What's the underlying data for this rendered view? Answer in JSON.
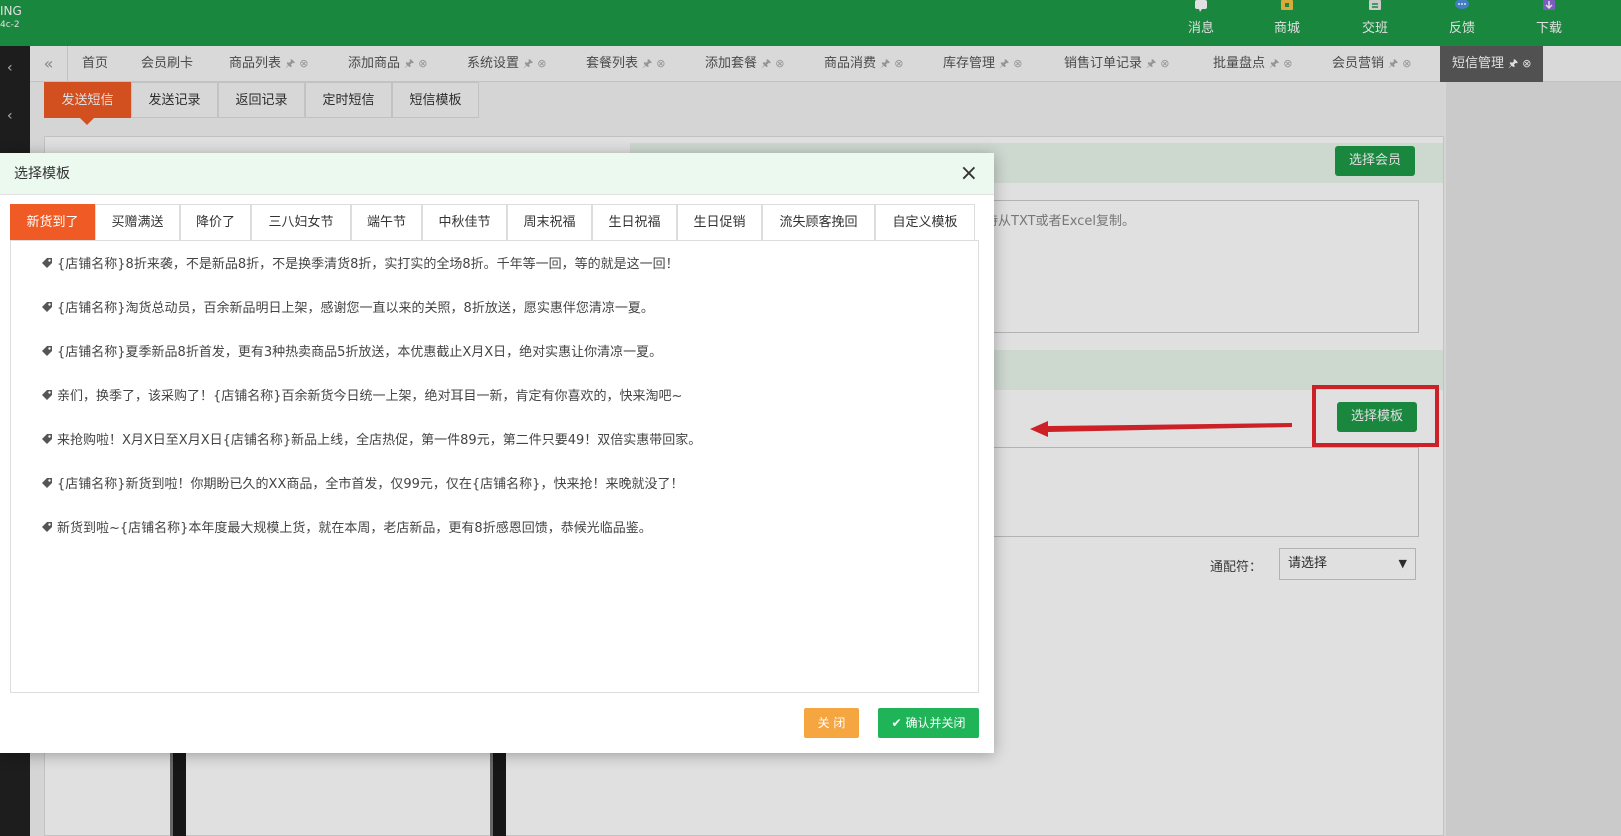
{
  "header": {
    "logo_fragment_top": "ING",
    "logo_fragment_bottom": "4c-2",
    "nav": [
      {
        "label": "消息",
        "icon": "message-icon"
      },
      {
        "label": "商城",
        "icon": "shop-icon"
      },
      {
        "label": "交班",
        "icon": "shift-change-icon"
      },
      {
        "label": "反馈",
        "icon": "feedback-icon"
      },
      {
        "label": "下载",
        "icon": "download-icon"
      }
    ]
  },
  "left_strip": {
    "arrow_1": "‹",
    "arrow_2": "‹"
  },
  "tabbar": {
    "back_glyph": "«",
    "tabs": [
      {
        "label": "首页"
      },
      {
        "label": "会员刷卡"
      },
      {
        "label": "商品列表"
      },
      {
        "label": "添加商品"
      },
      {
        "label": "系统设置"
      },
      {
        "label": "套餐列表"
      },
      {
        "label": "添加套餐"
      },
      {
        "label": "商品消费"
      },
      {
        "label": "库存管理"
      },
      {
        "label": "销售订单记录"
      },
      {
        "label": "批量盘点"
      },
      {
        "label": "会员营销"
      },
      {
        "label": "短信管理"
      }
    ],
    "pin_glyph": "🖈",
    "close_glyph": "⊗"
  },
  "subtabs": [
    "发送短信",
    "发送记录",
    "返回记录",
    "定时短信",
    "短信模板"
  ],
  "background": {
    "select_member_btn": "选择会员",
    "member_hint": "持从TXT或者Excel复制。",
    "select_template_btn": "选择模板",
    "wildcard_label": "通配符：",
    "wildcard_value": "请选择"
  },
  "modal": {
    "title": "选择模板",
    "close_glyph": "×",
    "tabs": [
      "新货到了",
      "买赠满送",
      "降价了",
      "三八妇女节",
      "端午节",
      "中秋佳节",
      "周末祝福",
      "生日祝福",
      "生日促销",
      "流失顾客挽回",
      "自定义模板"
    ],
    "templates": [
      "{店铺名称}8折来袭，不是新品8折，不是换季清货8折，实打实的全场8折。千年等一回，等的就是这一回！",
      "{店铺名称}淘货总动员，百余新品明日上架，感谢您一直以来的关照，8折放送，愿实惠伴您清凉一夏。",
      "{店铺名称}夏季新品8折首发，更有3种热卖商品5折放送，本优惠截止X月X日，绝对实惠让你清凉一夏。",
      "亲们，换季了，该采购了！{店铺名称}百余新货今日统一上架，绝对耳目一新，肯定有你喜欢的，快来淘吧~",
      "来抢购啦！X月X日至X月X日{店铺名称}新品上线，全店热促，第一件89元，第二件只要49！双倍实惠带回家。",
      "{店铺名称}新货到啦！你期盼已久的XX商品，全市首发，仅99元，仅在{店铺名称}，快来抢！来晚就没了！",
      "新货到啦~{店铺名称}本年度最大规模上货，就在本周，老店新品，更有8折感恩回馈，恭候光临品鉴。"
    ],
    "btn_close": "关 闭",
    "btn_confirm": "确认并关闭",
    "check_glyph": "✔"
  }
}
